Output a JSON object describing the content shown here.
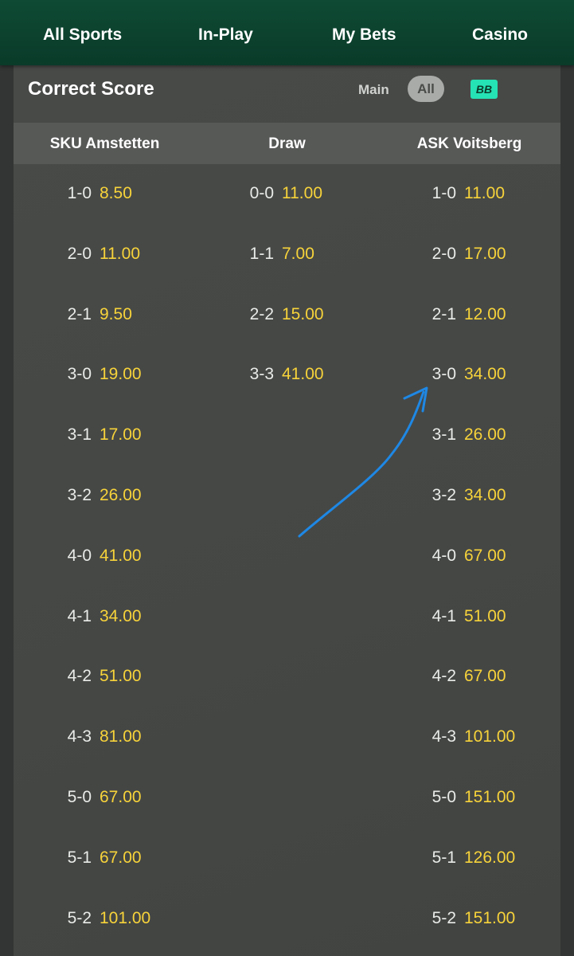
{
  "nav": {
    "tabs": [
      "All Sports",
      "In-Play",
      "My Bets",
      "Casino"
    ]
  },
  "market": {
    "title": "Correct Score",
    "filter_main": "Main",
    "filter_all": "All",
    "bb_badge": "BB"
  },
  "columns": [
    "SKU Amstetten",
    "Draw",
    "ASK Voitsberg"
  ],
  "home": [
    {
      "score": "1-0",
      "odds": "8.50"
    },
    {
      "score": "2-0",
      "odds": "11.00"
    },
    {
      "score": "2-1",
      "odds": "9.50"
    },
    {
      "score": "3-0",
      "odds": "19.00"
    },
    {
      "score": "3-1",
      "odds": "17.00"
    },
    {
      "score": "3-2",
      "odds": "26.00"
    },
    {
      "score": "4-0",
      "odds": "41.00"
    },
    {
      "score": "4-1",
      "odds": "34.00"
    },
    {
      "score": "4-2",
      "odds": "51.00"
    },
    {
      "score": "4-3",
      "odds": "81.00"
    },
    {
      "score": "5-0",
      "odds": "67.00"
    },
    {
      "score": "5-1",
      "odds": "67.00"
    },
    {
      "score": "5-2",
      "odds": "101.00"
    }
  ],
  "draw": [
    {
      "score": "0-0",
      "odds": "11.00"
    },
    {
      "score": "1-1",
      "odds": "7.00"
    },
    {
      "score": "2-2",
      "odds": "15.00"
    },
    {
      "score": "3-3",
      "odds": "41.00"
    }
  ],
  "away": [
    {
      "score": "1-0",
      "odds": "11.00"
    },
    {
      "score": "2-0",
      "odds": "17.00"
    },
    {
      "score": "2-1",
      "odds": "12.00"
    },
    {
      "score": "3-0",
      "odds": "34.00"
    },
    {
      "score": "3-1",
      "odds": "26.00"
    },
    {
      "score": "3-2",
      "odds": "34.00"
    },
    {
      "score": "4-0",
      "odds": "67.00"
    },
    {
      "score": "4-1",
      "odds": "51.00"
    },
    {
      "score": "4-2",
      "odds": "67.00"
    },
    {
      "score": "4-3",
      "odds": "101.00"
    },
    {
      "score": "5-0",
      "odds": "151.00"
    },
    {
      "score": "5-1",
      "odds": "126.00"
    },
    {
      "score": "5-2",
      "odds": "151.00"
    }
  ],
  "colors": {
    "nav_bg": "#0a3b29",
    "odds": "#f7d33a",
    "badge": "#25e3b4",
    "annotation_arrow": "#1e88e5"
  }
}
